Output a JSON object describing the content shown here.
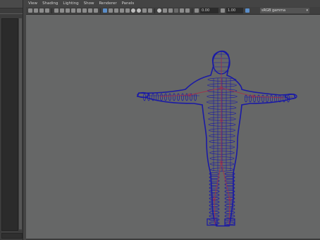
{
  "menu": {
    "items": [
      "View",
      "Shading",
      "Lighting",
      "Show",
      "Renderer",
      "Panels"
    ]
  },
  "toolbar": {
    "exposure_value": "0.00",
    "gamma_value": "1.00",
    "color_space": "sRGB gamma"
  },
  "colors": {
    "viewport_background": "#666767",
    "wireframe": "#1a1aa6",
    "skeleton": "#a0324a",
    "accent": "#5b8ec9"
  },
  "icons": {
    "viewport": "character-wireframe-model"
  }
}
